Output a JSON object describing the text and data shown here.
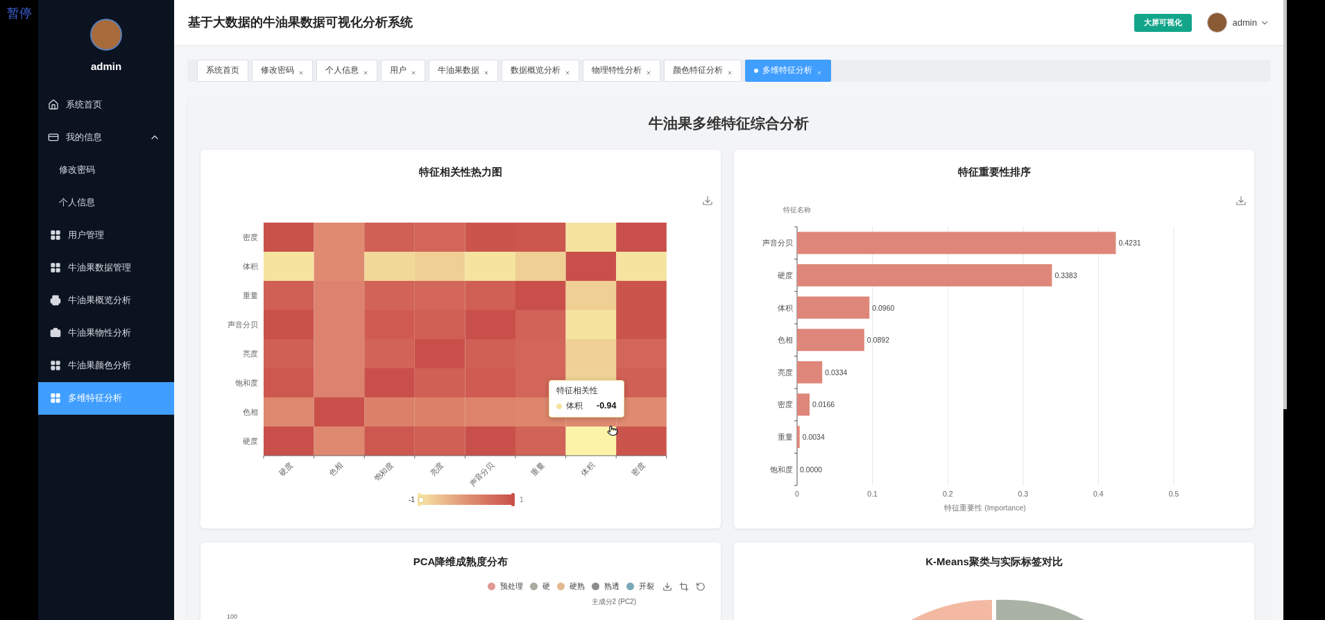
{
  "player_overlay": {
    "label": "暂停"
  },
  "sidebar": {
    "username": "admin",
    "items": [
      {
        "label": "系统首页",
        "selected": false
      },
      {
        "label": "我的信息",
        "selected": false,
        "expanded": true,
        "children": [
          {
            "label": "修改密码",
            "selected": false
          },
          {
            "label": "个人信息",
            "selected": false
          }
        ]
      },
      {
        "label": "用户管理",
        "selected": false
      },
      {
        "label": "牛油果数据管理",
        "selected": false
      },
      {
        "label": "牛油果概览分析",
        "selected": false
      },
      {
        "label": "牛油果物性分析",
        "selected": false
      },
      {
        "label": "牛油果颜色分析",
        "selected": false
      },
      {
        "label": "多维特征分析",
        "selected": true
      }
    ]
  },
  "header": {
    "title": "基于大数据的牛油果数据可视化分析系统",
    "screen_button": "大屏可视化",
    "user": "admin"
  },
  "tabs": [
    {
      "label": "系统首页",
      "selected": false,
      "closable": false
    },
    {
      "label": "修改密码",
      "selected": false,
      "closable": true
    },
    {
      "label": "个人信息",
      "selected": false,
      "closable": true
    },
    {
      "label": "用户",
      "selected": false,
      "closable": true
    },
    {
      "label": "牛油果数据",
      "selected": false,
      "closable": true
    },
    {
      "label": "数据概览分析",
      "selected": false,
      "closable": true
    },
    {
      "label": "物理特性分析",
      "selected": false,
      "closable": true
    },
    {
      "label": "颜色特征分析",
      "selected": false,
      "closable": true
    },
    {
      "label": "多维特征分析",
      "selected": true,
      "closable": true
    }
  ],
  "page_title": "牛油果多维特征综合分析",
  "heatmap": {
    "title": "特征相关性热力图",
    "y_labels": [
      "密度",
      "体积",
      "重量",
      "声音分贝",
      "亮度",
      "饱和度",
      "色相",
      "硬度"
    ],
    "x_labels": [
      "硬度",
      "色相",
      "饱和度",
      "亮度",
      "声音分贝",
      "重量",
      "体积",
      "密度"
    ],
    "rows": [
      {
        "cells": [
          {
            "color": "#c9524b"
          },
          {
            "color": "#e08a72"
          },
          {
            "color": "#d05f55"
          },
          {
            "color": "#d3665a"
          },
          {
            "color": "#cb554d"
          },
          {
            "color": "#cc574f"
          },
          {
            "color": "#f5e39f"
          },
          {
            "color": "#c9504a"
          }
        ]
      },
      {
        "cells": [
          {
            "color": "#f5e39f"
          },
          {
            "color": "#e08a72"
          },
          {
            "color": "#f2d898"
          },
          {
            "color": "#f0cf94"
          },
          {
            "color": "#f5e39f"
          },
          {
            "color": "#f0cf94"
          },
          {
            "color": "#c9504a"
          },
          {
            "color": "#f5e39f"
          }
        ]
      },
      {
        "cells": [
          {
            "color": "#d05f55"
          },
          {
            "color": "#de8270"
          },
          {
            "color": "#d26358"
          },
          {
            "color": "#d3665a"
          },
          {
            "color": "#d05f55"
          },
          {
            "color": "#c9504a"
          },
          {
            "color": "#f0cf94"
          },
          {
            "color": "#cb554d"
          }
        ]
      },
      {
        "cells": [
          {
            "color": "#c9524b"
          },
          {
            "color": "#de8270"
          },
          {
            "color": "#cf5b53"
          },
          {
            "color": "#d05f55"
          },
          {
            "color": "#c9504a"
          },
          {
            "color": "#d26358"
          },
          {
            "color": "#f5e39f"
          },
          {
            "color": "#cb554d"
          }
        ]
      },
      {
        "cells": [
          {
            "color": "#d05f55"
          },
          {
            "color": "#de8270"
          },
          {
            "color": "#d26358"
          },
          {
            "color": "#c9504a"
          },
          {
            "color": "#d05f55"
          },
          {
            "color": "#d3665a"
          },
          {
            "color": "#f0cf94"
          },
          {
            "color": "#d3665a"
          }
        ]
      },
      {
        "cells": [
          {
            "color": "#cd5850"
          },
          {
            "color": "#de8270"
          },
          {
            "color": "#c9504a"
          },
          {
            "color": "#d05f55"
          },
          {
            "color": "#cf5b53"
          },
          {
            "color": "#d3665a"
          },
          {
            "color": "#f0d296"
          },
          {
            "color": "#d05f55"
          }
        ]
      },
      {
        "cells": [
          {
            "color": "#df8870"
          },
          {
            "color": "#c9504a"
          },
          {
            "color": "#dc8069"
          },
          {
            "color": "#dc8069"
          },
          {
            "color": "#dd836b"
          },
          {
            "color": "#de866d"
          },
          {
            "color": "#e08a72"
          },
          {
            "color": "#e08a72"
          }
        ]
      },
      {
        "cells": [
          {
            "color": "#c9504a"
          },
          {
            "color": "#df8870"
          },
          {
            "color": "#cd5850"
          },
          {
            "color": "#d05f55"
          },
          {
            "color": "#c9504a"
          },
          {
            "color": "#d26358"
          },
          {
            "color": "#fdf3a8"
          },
          {
            "color": "#cb554d"
          }
        ]
      }
    ],
    "scale_min": "-1",
    "scale_max": "1",
    "tooltip": {
      "title": "特征相关性",
      "name": "体积",
      "value": "-0.94",
      "color": "#f5e39f"
    }
  },
  "importance": {
    "chart_data": {
      "type": "bar",
      "orientation": "horizontal",
      "title": "特征重要性排序",
      "xlabel": "特征重要性 (Importance)",
      "ylabel": "特征名称",
      "categories": [
        "声音分贝",
        "硬度",
        "体积",
        "色相",
        "亮度",
        "密度",
        "重量",
        "饱和度"
      ],
      "values": [
        0.4231,
        0.3383,
        0.096,
        0.0892,
        0.0334,
        0.0166,
        0.0034,
        0
      ],
      "xlim": [
        0,
        0.5
      ],
      "xticks": [
        0,
        0.1,
        0.2,
        0.3,
        0.4,
        0.5
      ],
      "grid": true,
      "value_labels": [
        "0.4231",
        "0.3383",
        "0.0960",
        "0.0892",
        "0.0334",
        "0.0166",
        "0.0034",
        "0.0000"
      ]
    }
  },
  "pca": {
    "title": "PCA降维成熟度分布",
    "axis_name": "主成分2 (PC2)",
    "y_tick": "100",
    "legend": [
      {
        "label": "预处理",
        "color": "#e09a93"
      },
      {
        "label": "硬",
        "color": "#a8ad9f"
      },
      {
        "label": "硬熟",
        "color": "#e3b98f"
      },
      {
        "label": "熟透",
        "color": "#8c8c8c"
      },
      {
        "label": "开裂",
        "color": "#7aa9b5"
      }
    ]
  },
  "kmeans": {
    "title": "K-Means聚类与实际标签对比"
  }
}
